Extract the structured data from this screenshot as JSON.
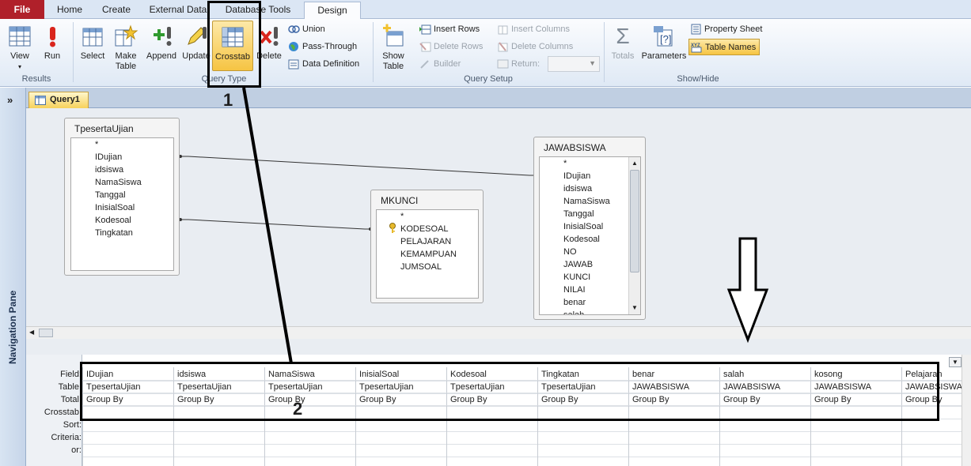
{
  "tabs": {
    "file": "File",
    "home": "Home",
    "create": "Create",
    "external": "External Data",
    "dbtools": "Database Tools",
    "design": "Design"
  },
  "ribbon": {
    "view": "View",
    "run": "Run",
    "results": "Results",
    "select": "Select",
    "make_table": "Make Table",
    "append": "Append",
    "update": "Update",
    "crosstab": "Crosstab",
    "delete": "Delete",
    "union": "Union",
    "pass_through": "Pass-Through",
    "data_definition": "Data Definition",
    "query_type": "Query Type",
    "show_table": "Show Table",
    "insert_rows": "Insert Rows",
    "delete_rows": "Delete Rows",
    "builder": "Builder",
    "insert_columns": "Insert Columns",
    "delete_columns": "Delete Columns",
    "return": "Return:",
    "query_setup": "Query Setup",
    "totals": "Totals",
    "parameters": "Parameters",
    "property_sheet": "Property Sheet",
    "table_names": "Table Names",
    "show_hide": "Show/Hide"
  },
  "nav_pane": {
    "title": "Navigation Pane",
    "toggle": "»"
  },
  "query_tab": "Query1",
  "tables": {
    "tpeserta": {
      "title": "TpesertaUjian",
      "fields": [
        "*",
        "IDujian",
        "idsiswa",
        "NamaSiswa",
        "Tanggal",
        "InisialSoal",
        "Kodesoal",
        "Tingkatan"
      ]
    },
    "mkunci": {
      "title": "MKUNCI",
      "fields": [
        "*",
        "KODESOAL",
        "PELAJARAN",
        "KEMAMPUAN",
        "JUMSOAL"
      ]
    },
    "jawab": {
      "title": "JAWABSISWA",
      "fields": [
        "*",
        "IDujian",
        "idsiswa",
        "NamaSiswa",
        "Tanggal",
        "InisialSoal",
        "Kodesoal",
        "NO",
        "JAWAB",
        "KUNCI",
        "NILAI",
        "benar",
        "salah"
      ]
    }
  },
  "grid": {
    "row_labels": [
      "Field:",
      "Table:",
      "Total:",
      "Crosstab:",
      "Sort:",
      "Criteria:",
      "or:"
    ],
    "columns": [
      {
        "field": "IDujian",
        "table": "TpesertaUjian",
        "total": "Group By"
      },
      {
        "field": "idsiswa",
        "table": "TpesertaUjian",
        "total": "Group By"
      },
      {
        "field": "NamaSiswa",
        "table": "TpesertaUjian",
        "total": "Group By"
      },
      {
        "field": "InisialSoal",
        "table": "TpesertaUjian",
        "total": "Group By"
      },
      {
        "field": "Kodesoal",
        "table": "TpesertaUjian",
        "total": "Group By"
      },
      {
        "field": "Tingkatan",
        "table": "TpesertaUjian",
        "total": "Group By"
      },
      {
        "field": "benar",
        "table": "JAWABSISWA",
        "total": "Group By"
      },
      {
        "field": "salah",
        "table": "JAWABSISWA",
        "total": "Group By"
      },
      {
        "field": "kosong",
        "table": "JAWABSISWA",
        "total": "Group By"
      },
      {
        "field": "Pelajaran",
        "table": "JAWABSISWA",
        "total": "Group By"
      }
    ]
  },
  "annotations": {
    "label1": "1",
    "label2": "2"
  }
}
